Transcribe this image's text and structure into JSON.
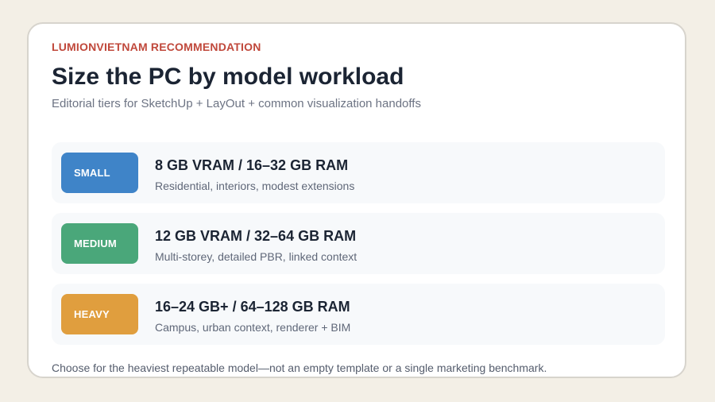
{
  "card": {
    "eyebrow": "LUMIONVIETNAM RECOMMENDATION",
    "title": "Size the PC by model workload",
    "subtitle": "Editorial tiers for SketchUp + LayOut + common visualization handoffs",
    "tiers": [
      {
        "badge": "SMALL",
        "badge_color": "#3f84c8",
        "spec": "8 GB VRAM / 16–32 GB RAM",
        "description": "Residential, interiors, modest extensions"
      },
      {
        "badge": "MEDIUM",
        "badge_color": "#4aa77a",
        "spec": "12 GB VRAM / 32–64 GB RAM",
        "description": "Multi-storey, detailed PBR, linked context"
      },
      {
        "badge": "HEAVY",
        "badge_color": "#e09e3e",
        "spec": "16–24 GB+ / 64–128 GB RAM",
        "description": "Campus, urban context, renderer + BIM"
      }
    ],
    "footnote": "Choose for the heaviest repeatable model—not an empty template or a single marketing benchmark."
  }
}
